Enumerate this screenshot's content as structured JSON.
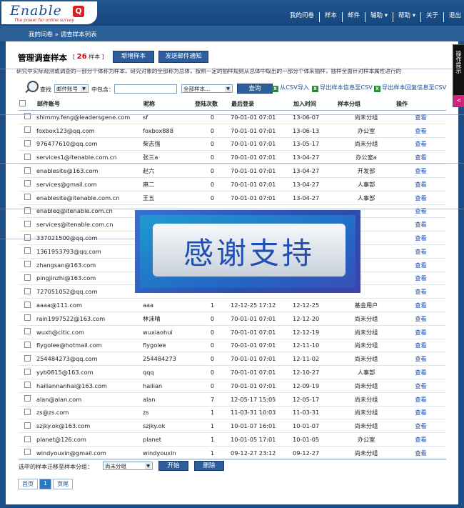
{
  "app": {
    "logo_text": "Enable",
    "logo_q": "Q",
    "logo_tagline": "The power for online survey"
  },
  "topnav": [
    "我的问卷",
    "样本",
    "邮件",
    "辅助 ▾",
    "帮助 ▾",
    "关于",
    "退出"
  ],
  "breadcrumb": "我的问卷 » 调查样本列表",
  "page": {
    "title": "管理调查样本",
    "count_prefix": "[",
    "count": "26",
    "count_suffix": "样本 ]",
    "add_sample_label": "新增样本",
    "send_mail_label": "发送邮件通知",
    "description": "研究中实际观测或调查的一部分个体称为样本，研究对象的全部称为总体，按照一定的抽样规则从总体中取出的一部分个体来抽样，抽样全面针对样本属性进行的"
  },
  "filter": {
    "search_label": "查找",
    "field_value": "邮件账号",
    "contains_label": "中包含：",
    "keyword_value": "",
    "group_value": "全部样本...",
    "query_label": "查询",
    "import_label": "从CSV导入",
    "export_info_label": "导出样本信息至CSV",
    "export_reply_label": "导出样本回复信息至CSV"
  },
  "table": {
    "headers": [
      "邮件账号",
      "昵称",
      "登陆次数",
      "最后登录",
      "加入时间",
      "样本分组",
      "操作"
    ],
    "rows": [
      {
        "email": "shimmy.feng@leadersgene.com",
        "nick": "sf",
        "count": "0",
        "last": "70-01-01 07:01",
        "join": "13-06-07",
        "group": "尚未分组",
        "op": "查看"
      },
      {
        "email": "foxbox123@qq.com",
        "nick": "foxbox888",
        "count": "0",
        "last": "70-01-01 07:01",
        "join": "13-06-13",
        "group": "办公室",
        "op": "查看"
      },
      {
        "email": "976477610@qq.com",
        "nick": "柴志强",
        "count": "0",
        "last": "70-01-01 07:01",
        "join": "13-05-17",
        "group": "尚未分组",
        "op": "查看"
      },
      {
        "email": "services1@itenable.com.cn",
        "nick": "张三a",
        "count": "0",
        "last": "70-01-01 07:01",
        "join": "13-04-27",
        "group": "办公室a",
        "op": "查看"
      },
      {
        "email": "enablesite@163.com",
        "nick": "赵六",
        "count": "0",
        "last": "70-01-01 07:01",
        "join": "13-04-27",
        "group": "开发部",
        "op": "查看"
      },
      {
        "email": "services@gmail.com",
        "nick": "麻二",
        "count": "0",
        "last": "70-01-01 07:01",
        "join": "13-04-27",
        "group": "人事部",
        "op": "查看"
      },
      {
        "email": "enablesite@itenable.com.cn",
        "nick": "王五",
        "count": "0",
        "last": "70-01-01 07:01",
        "join": "13-04-27",
        "group": "人事部",
        "op": "查看"
      },
      {
        "email": "enableq@itenable.com.cn",
        "nick": "",
        "count": "",
        "last": "",
        "join": "",
        "group": "",
        "op": "查看"
      },
      {
        "email": "services@itenable.com.cn",
        "nick": "",
        "count": "",
        "last": "",
        "join": "",
        "group": "",
        "op": "查看"
      },
      {
        "email": "337021500@qq.com",
        "nick": "",
        "count": "",
        "last": "",
        "join": "",
        "group": "",
        "op": "查看"
      },
      {
        "email": "1361953793@qq.com",
        "nick": "",
        "count": "",
        "last": "",
        "join": "",
        "group": "",
        "op": "查看"
      },
      {
        "email": "zhangsan@163.com",
        "nick": "",
        "count": "",
        "last": "",
        "join": "",
        "group": "",
        "op": "查看"
      },
      {
        "email": "pingjinzhi@163.com",
        "nick": "",
        "count": "",
        "last": "",
        "join": "",
        "group": "",
        "op": "查看"
      },
      {
        "email": "727051052@qq.com",
        "nick": "",
        "count": "",
        "last": "",
        "join": "",
        "group": "",
        "op": "查看"
      },
      {
        "email": "aaaa@111.com",
        "nick": "aaa",
        "count": "1",
        "last": "12-12-25 17:12",
        "join": "12-12-25",
        "group": "基金用户",
        "op": "查看"
      },
      {
        "email": "rain1997522@163.com",
        "nick": "林沫晴",
        "count": "0",
        "last": "70-01-01 07:01",
        "join": "12-12-20",
        "group": "尚未分组",
        "op": "查看"
      },
      {
        "email": "wuxh@citic.com",
        "nick": "wuxiaohui",
        "count": "0",
        "last": "70-01-01 07:01",
        "join": "12-12-19",
        "group": "尚未分组",
        "op": "查看"
      },
      {
        "email": "flygolee@hotmail.com",
        "nick": "flygolee",
        "count": "0",
        "last": "70-01-01 07:01",
        "join": "12-11-10",
        "group": "尚未分组",
        "op": "查看"
      },
      {
        "email": "254484273@qq.com",
        "nick": "254484273",
        "count": "0",
        "last": "70-01-01 07:01",
        "join": "12-11-02",
        "group": "尚未分组",
        "op": "查看"
      },
      {
        "email": "yyb0815@163.com",
        "nick": "qqq",
        "count": "0",
        "last": "70-01-01 07:01",
        "join": "12-10-27",
        "group": "人事部",
        "op": "查看"
      },
      {
        "email": "hailiannanhai@163.com",
        "nick": "hailian",
        "count": "0",
        "last": "70-01-01 07:01",
        "join": "12-09-19",
        "group": "尚未分组",
        "op": "查看"
      },
      {
        "email": "alan@alan.com",
        "nick": "alan",
        "count": "7",
        "last": "12-05-17 15:05",
        "join": "12-05-17",
        "group": "尚未分组",
        "op": "查看"
      },
      {
        "email": "zs@zs.com",
        "nick": "zs",
        "count": "1",
        "last": "11-03-31 10:03",
        "join": "11-03-31",
        "group": "尚未分组",
        "op": "查看"
      },
      {
        "email": "szjky.ok@163.com",
        "nick": "szjky.ok",
        "count": "1",
        "last": "10-01-07 16:01",
        "join": "10-01-07",
        "group": "尚未分组",
        "op": "查看"
      },
      {
        "email": "planet@126.com",
        "nick": "planet",
        "count": "1",
        "last": "10-01-05 17:01",
        "join": "10-01-05",
        "group": "办公室",
        "op": "查看"
      },
      {
        "email": "windyouxin@gmail.com",
        "nick": "windyouxin",
        "count": "1",
        "last": "09-12-27 23:12",
        "join": "09-12-27",
        "group": "尚未分组",
        "op": "查看"
      }
    ]
  },
  "bottom": {
    "move_label": "选中的样本迁移至样本分组：",
    "move_value": "尚未分组",
    "start_label": "开始",
    "delete_label": "删除"
  },
  "pager": {
    "first": "首页",
    "current": "1",
    "last": "页尾"
  },
  "overlay_text": "感谢支持",
  "side_tab": {
    "label": "操作提示",
    "mark": "<"
  }
}
